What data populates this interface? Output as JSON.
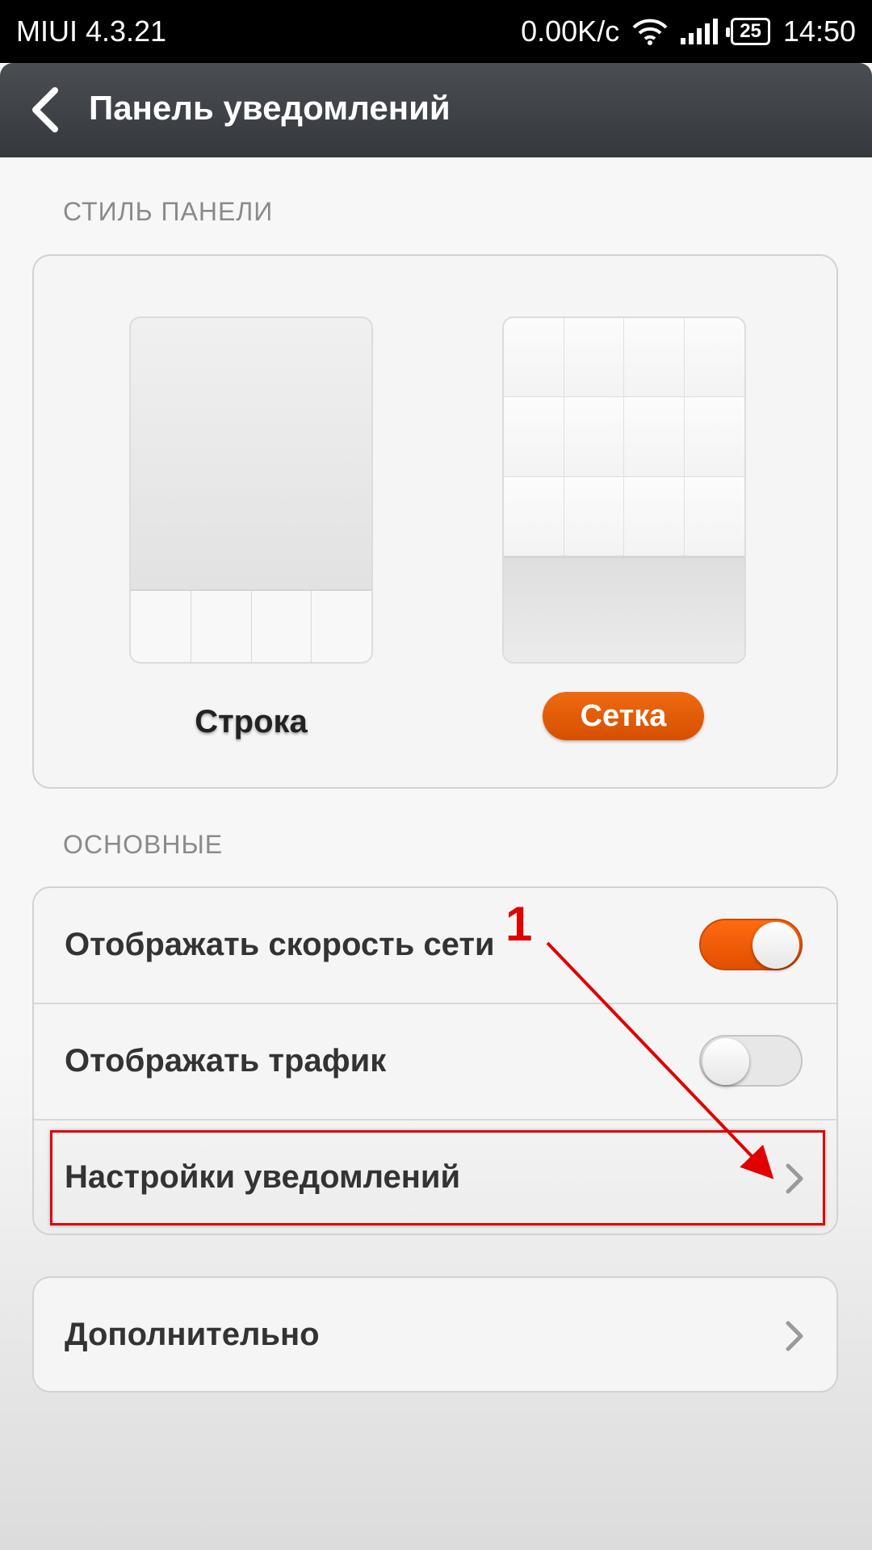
{
  "status_bar": {
    "left_text": "MIUI 4.3.21",
    "speed": "0.00K/c",
    "battery": "25",
    "time": "14:50"
  },
  "header": {
    "title": "Панель уведомлений",
    "back_icon": "back-arrow-icon"
  },
  "sections": {
    "style_label": "СТИЛЬ ПАНЕЛИ",
    "main_label": "ОСНОВНЫЕ"
  },
  "panel_style": {
    "options": [
      {
        "label": "Строка",
        "selected": false
      },
      {
        "label": "Сетка",
        "selected": true
      }
    ],
    "accent_color": "#e85c00"
  },
  "settings": {
    "show_speed": {
      "label": "Отображать скорость сети",
      "enabled": true
    },
    "show_traffic": {
      "label": "Отображать трафик",
      "enabled": false
    },
    "notification_settings": {
      "label": "Настройки уведомлений"
    },
    "additional": {
      "label": "Дополнительно"
    }
  },
  "annotation": {
    "number": "1",
    "color": "#e00000"
  }
}
